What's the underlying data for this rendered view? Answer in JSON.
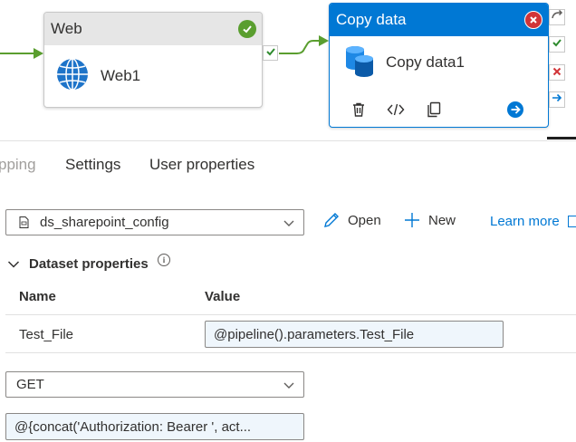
{
  "pipeline": {
    "web_activity": {
      "type_label": "Web",
      "name": "Web1",
      "status": "succeeded",
      "icon": "globe-icon"
    },
    "copy_activity": {
      "type_label": "Copy data",
      "name": "Copy data1",
      "status": "error",
      "icon": "database-icon",
      "actions": [
        "delete-icon",
        "code-icon",
        "clone-icon",
        "arrow-right-circle-icon"
      ]
    },
    "side_ports": [
      "redo-icon",
      "success-check-icon",
      "failure-x-icon",
      "completion-arrow-icon"
    ]
  },
  "tabs": {
    "mapping_partial": "pping",
    "settings": "Settings",
    "user_properties": "User properties"
  },
  "dataset": {
    "selected": "ds_sharepoint_config",
    "open_label": "Open",
    "new_label": "New",
    "learn_more": "Learn more"
  },
  "dataset_properties": {
    "title": "Dataset properties",
    "columns": {
      "name": "Name",
      "value": "Value"
    },
    "rows": [
      {
        "name": "Test_File",
        "value": "@pipeline().parameters.Test_File"
      }
    ]
  },
  "request": {
    "method": "GET",
    "headers_expression": "@{concat('Authorization: Bearer ', act..."
  },
  "colors": {
    "accent": "#0078d4",
    "success": "#5a9e2f",
    "error": "#d13438",
    "expression_bg": "#eff6fc"
  }
}
